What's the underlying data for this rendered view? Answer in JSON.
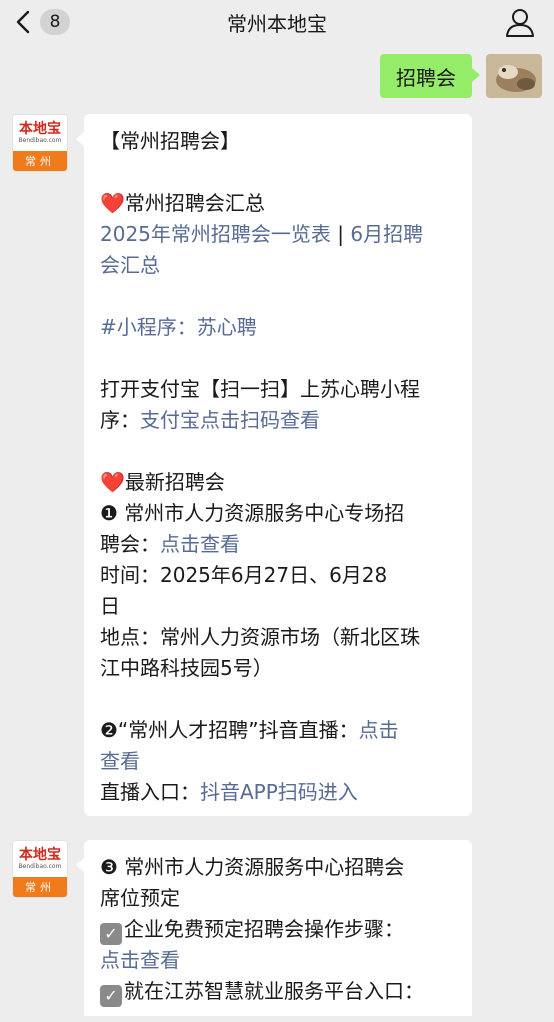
{
  "header": {
    "back_badge": "8",
    "title": "常州本地宝",
    "icons": {
      "back": "chevron-left-icon",
      "profile": "person-icon"
    }
  },
  "sent_message": {
    "text": "招聘会"
  },
  "account_logo": {
    "name": "本地宝",
    "domain": "Bendibao.com",
    "city": "常州"
  },
  "message1": {
    "line1": "【常州招聘会】",
    "sec1_title": "常州招聘会汇总",
    "sec1_link_a": "2025年常州招聘会一览表",
    "sec1_sep": " | ",
    "sec1_link_b": "6月招聘",
    "sec1_link_b2": "会汇总",
    "miniprogram": "#小程序：苏心聘",
    "alipay_l1": "打开支付宝【扫一扫】上苏心聘小程",
    "alipay_l2": "序：",
    "alipay_link": "支付宝点击扫码查看",
    "sec2_title": "最新招聘会",
    "item1_l1": "❶ 常州市人力资源服务中心专场招",
    "item1_l2": "聘会：",
    "item1_link": "点击查看",
    "time_l1": "时间：2025年6月27日、6月28",
    "time_l2": "日",
    "place_l1": "地点：常州人力资源市场（新北区珠",
    "place_l2": "江中路科技园5号）",
    "item2_l1": "❷“常州人才招聘”抖音直播：",
    "item2_link_a": "点击",
    "item2_link_b": "查看",
    "live_label": "直播入口：",
    "live_link": "抖音APP扫码进入"
  },
  "message2": {
    "item3_l1": "❸ 常州市人力资源服务中心招聘会",
    "item3_l2": "席位预定",
    "step_l1": "企业免费预定招聘会操作步骤：",
    "step_link": "点击查看",
    "entry_l1": "就在江苏智慧就业服务平台入口："
  },
  "colors": {
    "link": "#576b95",
    "sent_bubble": "#95ec69",
    "background": "#ededed",
    "heart": "#e8262b"
  }
}
